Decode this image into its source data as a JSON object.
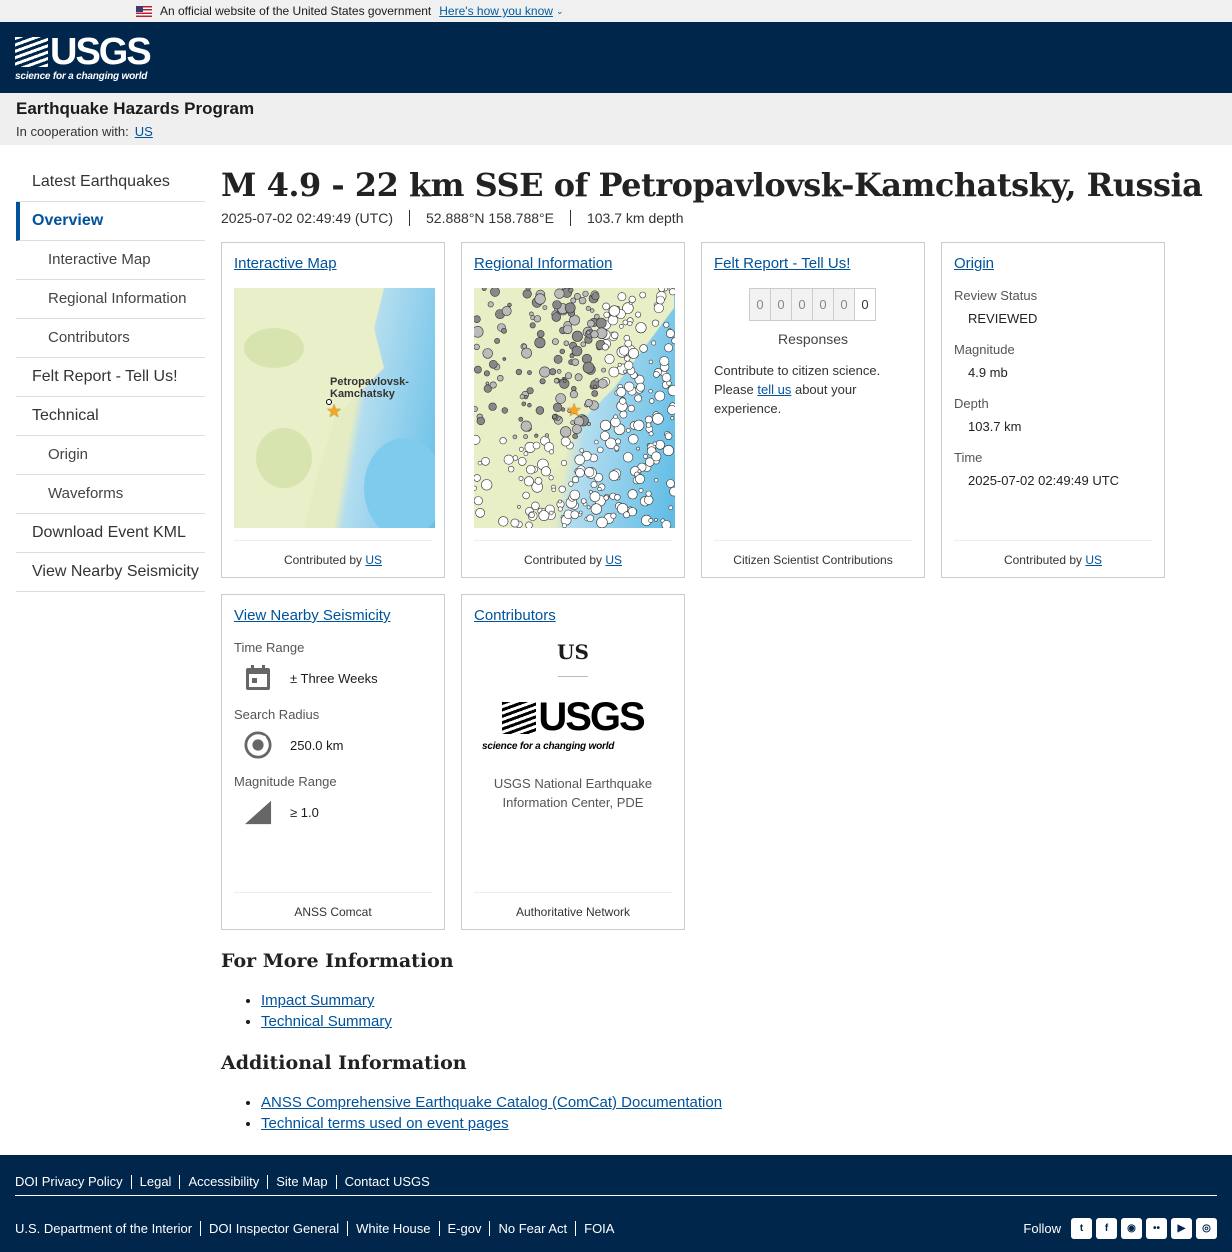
{
  "gov": {
    "text": "An official website of the United States government",
    "how": "Here's how you know"
  },
  "logo": {
    "word": "USGS",
    "tag": "science for a changing world"
  },
  "program": {
    "title": "Earthquake Hazards Program",
    "coop_label": "In cooperation with:",
    "coop_link": "US"
  },
  "nav": [
    {
      "label": "Latest Earthquakes",
      "sub": false,
      "active": false
    },
    {
      "label": "Overview",
      "sub": false,
      "active": true
    },
    {
      "label": "Interactive Map",
      "sub": true,
      "active": false
    },
    {
      "label": "Regional Information",
      "sub": true,
      "active": false
    },
    {
      "label": "Contributors",
      "sub": true,
      "active": false
    },
    {
      "label": "Felt Report - Tell Us!",
      "sub": false,
      "active": false
    },
    {
      "label": "Technical",
      "sub": false,
      "active": false
    },
    {
      "label": "Origin",
      "sub": true,
      "active": false
    },
    {
      "label": "Waveforms",
      "sub": true,
      "active": false
    },
    {
      "label": "Download Event KML",
      "sub": false,
      "active": false
    },
    {
      "label": "View Nearby Seismicity",
      "sub": false,
      "active": false
    }
  ],
  "event": {
    "title": "M 4.9 - 22 km SSE of Petropavlovsk-Kamchatsky, Russia",
    "time": "2025-07-02 02:49:49 (UTC)",
    "location": "52.888°N 158.788°E",
    "depth": "103.7 km depth"
  },
  "cards": {
    "map": {
      "title": "Interactive Map",
      "place": "Petropavlovsk-\nKamchatsky",
      "foot_prefix": "Contributed by",
      "foot_link": "US"
    },
    "regional": {
      "title": "Regional Information",
      "foot_prefix": "Contributed by",
      "foot_link": "US"
    },
    "felt": {
      "title": "Felt Report - Tell Us!",
      "digits": [
        "0",
        "0",
        "0",
        "0",
        "0",
        "0"
      ],
      "responses": "Responses",
      "text_a": "Contribute to citizen science. Please",
      "link": "tell us",
      "text_b": "about your experience.",
      "foot": "Citizen Scientist Contributions"
    },
    "origin": {
      "title": "Origin",
      "review_label": "Review Status",
      "review": "REVIEWED",
      "mag_label": "Magnitude",
      "mag": "4.9 mb",
      "depth_label": "Depth",
      "depth": "103.7 km",
      "time_label": "Time",
      "time": "2025-07-02 02:49:49 UTC",
      "foot_prefix": "Contributed by",
      "foot_link": "US"
    },
    "nearby": {
      "title": "View Nearby Seismicity",
      "time_label": "Time Range",
      "time": "± Three Weeks",
      "radius_label": "Search Radius",
      "radius": "250.0 km",
      "mag_label": "Magnitude Range",
      "mag": "≥ 1.0",
      "foot": "ANSS Comcat"
    },
    "contributors": {
      "title": "Contributors",
      "name": "US",
      "org": "USGS National Earthquake Information Center, PDE",
      "foot": "Authoritative Network"
    }
  },
  "more": {
    "title": "For More Information",
    "links": [
      "Impact Summary",
      "Technical Summary"
    ]
  },
  "additional": {
    "title": "Additional Information",
    "links": [
      "ANSS Comprehensive Earthquake Catalog (ComCat) Documentation",
      "Technical terms used on event pages"
    ]
  },
  "footer": {
    "row1": [
      "DOI Privacy Policy",
      "Legal",
      "Accessibility",
      "Site Map",
      "Contact USGS"
    ],
    "row2": [
      "U.S. Department of the Interior",
      "DOI Inspector General",
      "White House",
      "E-gov",
      "No Fear Act",
      "FOIA"
    ],
    "follow": "Follow",
    "social": [
      "twitter-icon",
      "facebook-icon",
      "github-icon",
      "flickr-icon",
      "youtube-icon",
      "instagram-icon"
    ]
  },
  "colors": {
    "header": "#00264c",
    "link": "#00529b",
    "star": "#f5a623"
  }
}
